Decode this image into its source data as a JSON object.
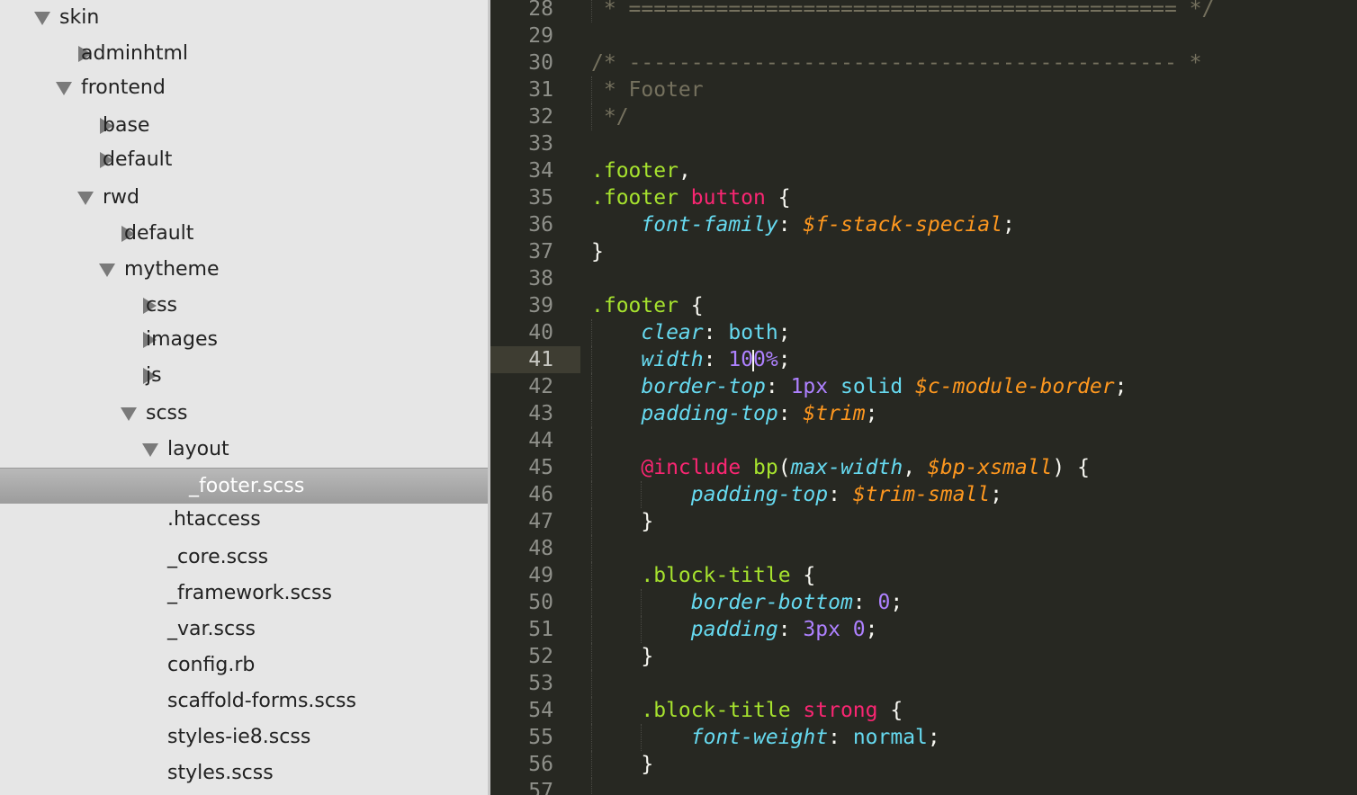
{
  "sidebar": {
    "items": [
      {
        "label": "skin",
        "depth": 0,
        "state": "expanded"
      },
      {
        "label": "adminhtml",
        "depth": 1,
        "state": "collapsed"
      },
      {
        "label": "frontend",
        "depth": 1,
        "state": "expanded"
      },
      {
        "label": "base",
        "depth": 2,
        "state": "collapsed"
      },
      {
        "label": "default",
        "depth": 2,
        "state": "collapsed"
      },
      {
        "label": "rwd",
        "depth": 2,
        "state": "expanded"
      },
      {
        "label": "default",
        "depth": 3,
        "state": "collapsed"
      },
      {
        "label": "mytheme",
        "depth": 3,
        "state": "expanded"
      },
      {
        "label": "css",
        "depth": 4,
        "state": "collapsed"
      },
      {
        "label": "images",
        "depth": 4,
        "state": "collapsed"
      },
      {
        "label": "js",
        "depth": 4,
        "state": "collapsed"
      },
      {
        "label": "scss",
        "depth": 4,
        "state": "expanded"
      },
      {
        "label": "layout",
        "depth": 5,
        "state": "expanded"
      },
      {
        "label": "_footer.scss",
        "depth": 6,
        "state": "file",
        "selected": true
      },
      {
        "label": ".htaccess",
        "depth": 5,
        "state": "file"
      },
      {
        "label": "_core.scss",
        "depth": 5,
        "state": "file"
      },
      {
        "label": "_framework.scss",
        "depth": 5,
        "state": "file"
      },
      {
        "label": "_var.scss",
        "depth": 5,
        "state": "file"
      },
      {
        "label": "config.rb",
        "depth": 5,
        "state": "file"
      },
      {
        "label": "scaffold-forms.scss",
        "depth": 5,
        "state": "file"
      },
      {
        "label": "styles-ie8.scss",
        "depth": 5,
        "state": "file"
      },
      {
        "label": "styles.scss",
        "depth": 5,
        "state": "file"
      }
    ]
  },
  "editor": {
    "current_line": "41",
    "lines": [
      {
        "num": "28",
        "guides": 1,
        "tokens": [
          [
            " * ============================================ */",
            "comment"
          ]
        ]
      },
      {
        "num": "29",
        "guides": 0,
        "tokens": []
      },
      {
        "num": "30",
        "guides": 0,
        "tokens": [
          [
            "/* -------------------------------------------- *",
            "comment"
          ]
        ]
      },
      {
        "num": "31",
        "guides": 1,
        "tokens": [
          [
            " * Footer",
            "comment"
          ]
        ]
      },
      {
        "num": "32",
        "guides": 1,
        "tokens": [
          [
            " */",
            "comment"
          ]
        ]
      },
      {
        "num": "33",
        "guides": 0,
        "tokens": []
      },
      {
        "num": "34",
        "guides": 0,
        "tokens": [
          [
            ".footer",
            "selector"
          ],
          [
            ",",
            "punct"
          ]
        ]
      },
      {
        "num": "35",
        "guides": 0,
        "tokens": [
          [
            ".footer",
            "selector"
          ],
          [
            " ",
            "plain"
          ],
          [
            "button",
            "keyword"
          ],
          [
            " {",
            "punct"
          ]
        ]
      },
      {
        "num": "36",
        "guides": 0,
        "tokens": [
          [
            "    ",
            "plain"
          ],
          [
            "font-family",
            "property"
          ],
          [
            ": ",
            "punct"
          ],
          [
            "$f-stack-special",
            "variable"
          ],
          [
            ";",
            "punct"
          ]
        ]
      },
      {
        "num": "37",
        "guides": 0,
        "tokens": [
          [
            "}",
            "punct"
          ]
        ]
      },
      {
        "num": "38",
        "guides": 0,
        "tokens": []
      },
      {
        "num": "39",
        "guides": 0,
        "tokens": [
          [
            ".footer",
            "selector"
          ],
          [
            " {",
            "punct"
          ]
        ]
      },
      {
        "num": "40",
        "guides": 1,
        "tokens": [
          [
            "    ",
            "plain"
          ],
          [
            "clear",
            "property"
          ],
          [
            ": ",
            "punct"
          ],
          [
            "both",
            "value"
          ],
          [
            ";",
            "punct"
          ]
        ]
      },
      {
        "num": "41",
        "guides": 1,
        "cursor_after": 1,
        "tokens": [
          [
            "    ",
            "plain"
          ],
          [
            "width",
            "property"
          ],
          [
            ": ",
            "punct"
          ],
          [
            "10",
            "number"
          ],
          [
            "0%",
            "number"
          ],
          [
            ";",
            "punct"
          ]
        ]
      },
      {
        "num": "42",
        "guides": 1,
        "tokens": [
          [
            "    ",
            "plain"
          ],
          [
            "border-top",
            "property"
          ],
          [
            ": ",
            "punct"
          ],
          [
            "1px",
            "number"
          ],
          [
            " solid ",
            "value"
          ],
          [
            "$c-module-border",
            "variable"
          ],
          [
            ";",
            "punct"
          ]
        ]
      },
      {
        "num": "43",
        "guides": 1,
        "tokens": [
          [
            "    ",
            "plain"
          ],
          [
            "padding-top",
            "property"
          ],
          [
            ": ",
            "punct"
          ],
          [
            "$trim",
            "variable"
          ],
          [
            ";",
            "punct"
          ]
        ]
      },
      {
        "num": "44",
        "guides": 1,
        "tokens": []
      },
      {
        "num": "45",
        "guides": 1,
        "tokens": [
          [
            "    ",
            "plain"
          ],
          [
            "@include",
            "keyword"
          ],
          [
            " ",
            "plain"
          ],
          [
            "bp",
            "func"
          ],
          [
            "(",
            "punct"
          ],
          [
            "max-width",
            "property"
          ],
          [
            ", ",
            "punct"
          ],
          [
            "$bp-xsmall",
            "variable"
          ],
          [
            ") {",
            "punct"
          ]
        ]
      },
      {
        "num": "46",
        "guides": 2,
        "tokens": [
          [
            "        ",
            "plain"
          ],
          [
            "padding-top",
            "property"
          ],
          [
            ": ",
            "punct"
          ],
          [
            "$trim-small",
            "variable"
          ],
          [
            ";",
            "punct"
          ]
        ]
      },
      {
        "num": "47",
        "guides": 1,
        "tokens": [
          [
            "    ",
            "plain"
          ],
          [
            "}",
            "punct"
          ]
        ]
      },
      {
        "num": "48",
        "guides": 1,
        "tokens": []
      },
      {
        "num": "49",
        "guides": 1,
        "tokens": [
          [
            "    ",
            "plain"
          ],
          [
            ".block-title",
            "selector"
          ],
          [
            " {",
            "punct"
          ]
        ]
      },
      {
        "num": "50",
        "guides": 2,
        "tokens": [
          [
            "        ",
            "plain"
          ],
          [
            "border-bottom",
            "property"
          ],
          [
            ": ",
            "punct"
          ],
          [
            "0",
            "number"
          ],
          [
            ";",
            "punct"
          ]
        ]
      },
      {
        "num": "51",
        "guides": 2,
        "tokens": [
          [
            "        ",
            "plain"
          ],
          [
            "padding",
            "property"
          ],
          [
            ": ",
            "punct"
          ],
          [
            "3px 0",
            "number"
          ],
          [
            ";",
            "punct"
          ]
        ]
      },
      {
        "num": "52",
        "guides": 1,
        "tokens": [
          [
            "    ",
            "plain"
          ],
          [
            "}",
            "punct"
          ]
        ]
      },
      {
        "num": "53",
        "guides": 1,
        "tokens": []
      },
      {
        "num": "54",
        "guides": 1,
        "tokens": [
          [
            "    ",
            "plain"
          ],
          [
            ".block-title",
            "selector"
          ],
          [
            " ",
            "plain"
          ],
          [
            "strong",
            "keyword"
          ],
          [
            " {",
            "punct"
          ]
        ]
      },
      {
        "num": "55",
        "guides": 2,
        "tokens": [
          [
            "        ",
            "plain"
          ],
          [
            "font-weight",
            "property"
          ],
          [
            ": ",
            "punct"
          ],
          [
            "normal",
            "value"
          ],
          [
            ";",
            "punct"
          ]
        ]
      },
      {
        "num": "56",
        "guides": 1,
        "tokens": [
          [
            "    ",
            "plain"
          ],
          [
            "}",
            "punct"
          ]
        ]
      },
      {
        "num": "57",
        "guides": 1,
        "tokens": []
      }
    ]
  }
}
